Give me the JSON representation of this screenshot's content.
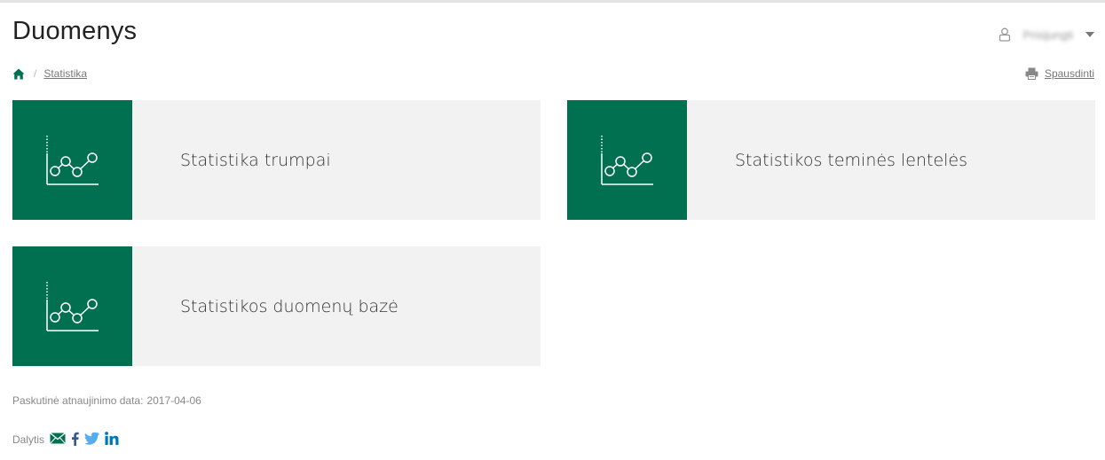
{
  "header": {
    "title": "Duomenys",
    "user_menu": {
      "name": "Prisijungti",
      "icon": "user-icon"
    }
  },
  "breadcrumb": {
    "home_icon": "home-icon",
    "separator": "/",
    "items": [
      {
        "label": "Statistika"
      }
    ]
  },
  "print": {
    "label": "Spausdinti",
    "icon": "print-icon"
  },
  "tiles": [
    {
      "label": "Statistika trumpai",
      "icon": "line-chart-icon"
    },
    {
      "label": "Statistikos teminės lentelės",
      "icon": "line-chart-icon"
    },
    {
      "label": "Statistikos duomenų bazė",
      "icon": "line-chart-icon"
    }
  ],
  "footer": {
    "last_update_label": "Paskutinė atnaujinimo data:",
    "last_update_date": "2017-04-06",
    "share_label": "Dalytis",
    "share_icons": [
      "email-icon",
      "facebook-icon",
      "twitter-icon",
      "linkedin-icon"
    ]
  },
  "colors": {
    "accent": "#007050",
    "tile_background": "#f2f2f2",
    "link_text": "#777777",
    "twitter": "#55acee",
    "linkedin": "#0077b5",
    "email": "#007050",
    "facebook": "#3b5998"
  }
}
